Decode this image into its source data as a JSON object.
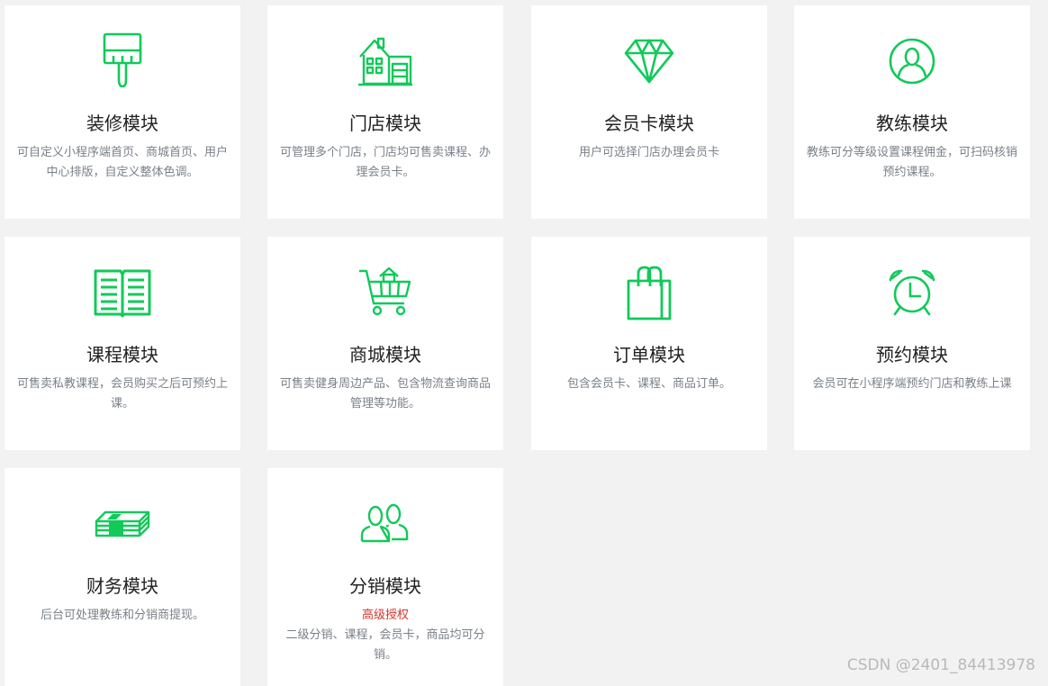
{
  "accent_color": "#12c95a",
  "modules": [
    {
      "icon": "paint-roller-icon",
      "title": "装修模块",
      "desc": "可自定义小程序端首页、商城首页、用户中心排版，自定义整体色调。"
    },
    {
      "icon": "store-building-icon",
      "title": "门店模块",
      "desc": "可管理多个门店，门店均可售卖课程、办理会员卡。"
    },
    {
      "icon": "diamond-icon",
      "title": "会员卡模块",
      "desc": "用户可选择门店办理会员卡"
    },
    {
      "icon": "user-circle-icon",
      "title": "教练模块",
      "desc": "教练可分等级设置课程佣金，可扫码核销预约课程。"
    },
    {
      "icon": "open-book-icon",
      "title": "课程模块",
      "desc": "可售卖私教课程，会员购买之后可预约上课。"
    },
    {
      "icon": "shopping-cart-icon",
      "title": "商城模块",
      "desc": "可售卖健身周边产品、包含物流查询商品管理等功能。"
    },
    {
      "icon": "shopping-bag-icon",
      "title": "订单模块",
      "desc": "包含会员卡、课程、商品订单。"
    },
    {
      "icon": "alarm-clock-icon",
      "title": "预约模块",
      "desc": "会员可在小程序端预约门店和教练上课"
    },
    {
      "icon": "money-stack-icon",
      "title": "财务模块",
      "desc": "后台可处理教练和分销商提现。"
    },
    {
      "icon": "users-icon",
      "title": "分销模块",
      "badge": "高级授权",
      "desc": "二级分销、课程，会员卡，商品均可分销。"
    }
  ],
  "watermark": "CSDN @2401_84413978"
}
